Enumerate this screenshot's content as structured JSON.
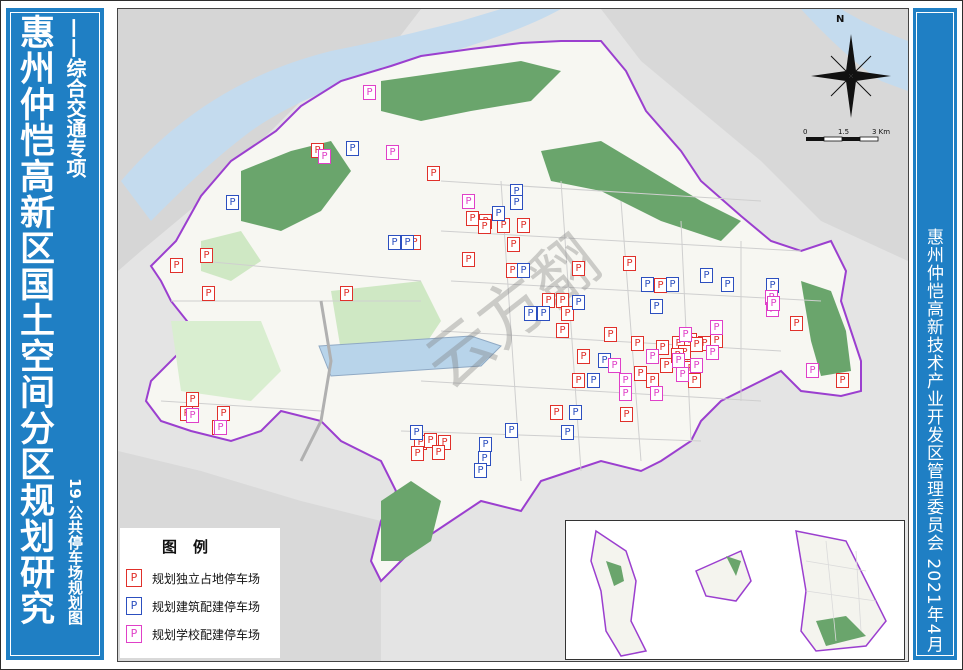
{
  "left_panel": {
    "title": "惠州仲恺高新区国土空间分区规划研究",
    "subtitle": "——综合交通专项",
    "figure_name": "19.公共停车场规划图"
  },
  "right_panel": {
    "organization_date": "惠州仲恺高新技术产业开发区管理委员会 2021年4月"
  },
  "compass": {
    "label": "N"
  },
  "scale_bar": {
    "labels": [
      "0",
      "1.5",
      "3 Km"
    ]
  },
  "watermark": {
    "text": "云方翻"
  },
  "legend": {
    "title": "图例",
    "items": [
      {
        "symbol": "P",
        "label": "规划独立占地停车场",
        "color": "#e0302a"
      },
      {
        "symbol": "P",
        "label": "规划建筑配建停车场",
        "color": "#2c4fbf"
      },
      {
        "symbol": "P",
        "label": "规划学校配建停车场",
        "color": "#e040c8"
      }
    ]
  },
  "parking_symbol": "P",
  "colors": {
    "panel_blue": "#1f7fc4",
    "district_boundary": "#9b3fcf",
    "green_space": "#6aa56c",
    "light_green": "#cfe8c4",
    "water": "#b8d4ea",
    "terrain": "#e6e6e6"
  },
  "markers": {
    "independent": [
      [
        317,
        150
      ],
      [
        206,
        255
      ],
      [
        176,
        265
      ],
      [
        208,
        293
      ],
      [
        346,
        293
      ],
      [
        433,
        173
      ],
      [
        472,
        218
      ],
      [
        485,
        221
      ],
      [
        503,
        225
      ],
      [
        513,
        244
      ],
      [
        523,
        225
      ],
      [
        484,
        226
      ],
      [
        414,
        242
      ],
      [
        468,
        259
      ],
      [
        512,
        270
      ],
      [
        578,
        268
      ],
      [
        629,
        263
      ],
      [
        660,
        285
      ],
      [
        548,
        300
      ],
      [
        562,
        300
      ],
      [
        567,
        313
      ],
      [
        562,
        330
      ],
      [
        610,
        334
      ],
      [
        583,
        356
      ],
      [
        637,
        343
      ],
      [
        662,
        347
      ],
      [
        678,
        343
      ],
      [
        690,
        340
      ],
      [
        704,
        343
      ],
      [
        716,
        340
      ],
      [
        640,
        373
      ],
      [
        652,
        380
      ],
      [
        666,
        365
      ],
      [
        690,
        368
      ],
      [
        694,
        380
      ],
      [
        578,
        380
      ],
      [
        556,
        412
      ],
      [
        626,
        414
      ],
      [
        420,
        442
      ],
      [
        430,
        440
      ],
      [
        444,
        442
      ],
      [
        438,
        452
      ],
      [
        417,
        453
      ],
      [
        192,
        399
      ],
      [
        223,
        413
      ],
      [
        186,
        413
      ],
      [
        218,
        427
      ],
      [
        796,
        323
      ],
      [
        842,
        380
      ],
      [
        684,
        352
      ],
      [
        696,
        344
      ],
      [
        677,
        355
      ]
    ],
    "building": [
      [
        232,
        202
      ],
      [
        352,
        148
      ],
      [
        394,
        242
      ],
      [
        407,
        242
      ],
      [
        516,
        191
      ],
      [
        516,
        202
      ],
      [
        498,
        213
      ],
      [
        543,
        313
      ],
      [
        530,
        313
      ],
      [
        604,
        360
      ],
      [
        593,
        380
      ],
      [
        575,
        412
      ],
      [
        511,
        430
      ],
      [
        567,
        432
      ],
      [
        485,
        444
      ],
      [
        484,
        458
      ],
      [
        480,
        470
      ],
      [
        416,
        432
      ],
      [
        647,
        284
      ],
      [
        672,
        284
      ],
      [
        706,
        275
      ],
      [
        727,
        284
      ],
      [
        772,
        285
      ],
      [
        656,
        306
      ],
      [
        578,
        302
      ],
      [
        523,
        270
      ]
    ],
    "school": [
      [
        369,
        92
      ],
      [
        324,
        156
      ],
      [
        392,
        152
      ],
      [
        468,
        201
      ],
      [
        685,
        334
      ],
      [
        716,
        327
      ],
      [
        678,
        360
      ],
      [
        652,
        356
      ],
      [
        696,
        365
      ],
      [
        682,
        374
      ],
      [
        771,
        297
      ],
      [
        772,
        309
      ],
      [
        812,
        370
      ],
      [
        625,
        380
      ],
      [
        625,
        393
      ],
      [
        656,
        393
      ],
      [
        712,
        352
      ],
      [
        614,
        365
      ],
      [
        192,
        415
      ],
      [
        220,
        427
      ],
      [
        773,
        303
      ]
    ]
  }
}
